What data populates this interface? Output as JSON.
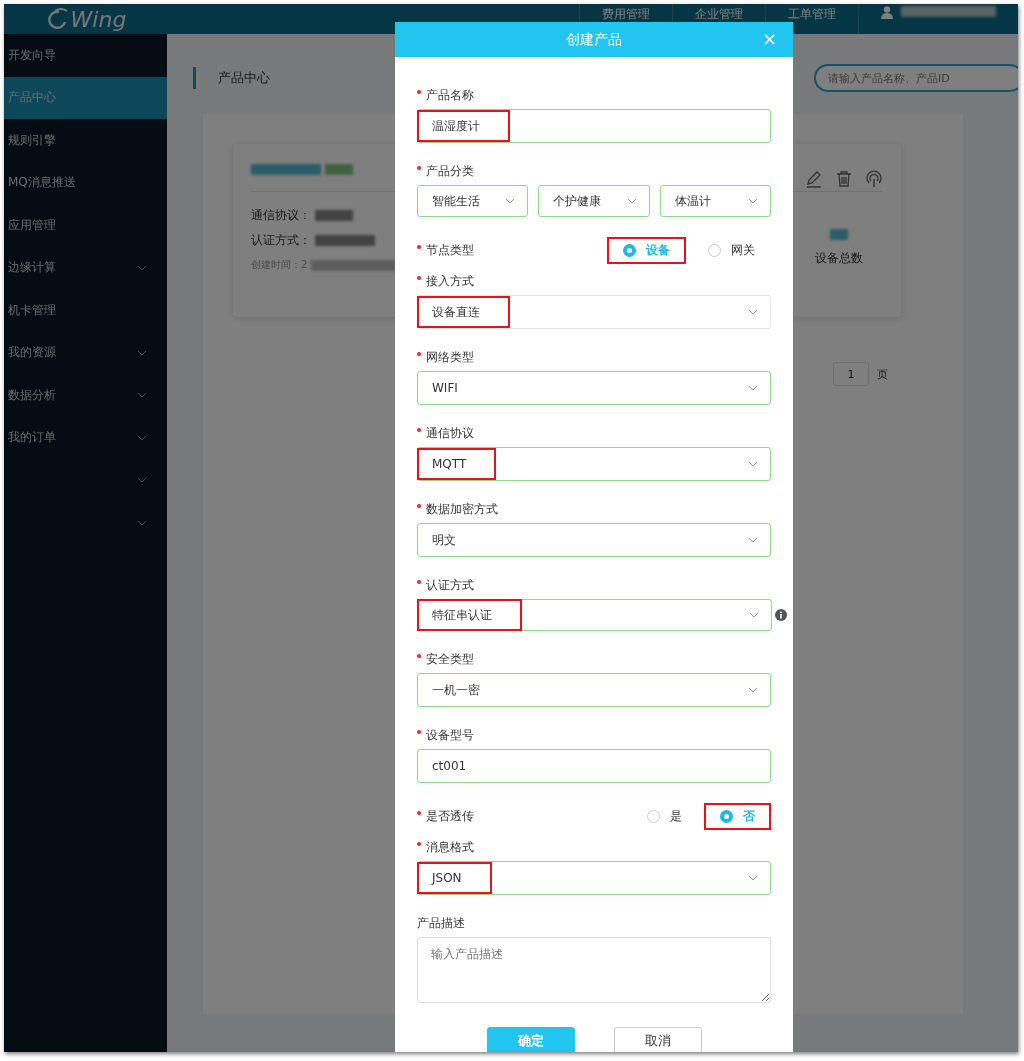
{
  "header": {
    "logo": "Wing",
    "nav": [
      "费用管理",
      "企业管理",
      "工单管理"
    ]
  },
  "sidebar": {
    "items": [
      {
        "label": "开发向导",
        "selected": false,
        "expandable": false
      },
      {
        "label": "产品中心",
        "selected": true,
        "expandable": false
      },
      {
        "label": "规则引擎",
        "selected": false,
        "expandable": false
      },
      {
        "label": "MQ消息推送",
        "selected": false,
        "expandable": false
      },
      {
        "label": "应用管理",
        "selected": false,
        "expandable": false
      },
      {
        "label": "边缘计算",
        "selected": false,
        "expandable": true
      },
      {
        "label": "机卡管理",
        "selected": false,
        "expandable": false
      },
      {
        "label": "我的资源",
        "selected": false,
        "expandable": true
      },
      {
        "label": "数据分析",
        "selected": false,
        "expandable": true
      },
      {
        "label": "我的订单",
        "selected": false,
        "expandable": true
      },
      {
        "selected": false,
        "expandable": true
      },
      {
        "selected": false,
        "expandable": true
      }
    ]
  },
  "main": {
    "title": "产品中心",
    "search": {
      "placeholder": "请输入产品名称、产品ID"
    },
    "card": {
      "rows": [
        "通信协议：",
        "认证方式："
      ],
      "created": "创建时间：2",
      "stat_label": "设备总数"
    },
    "pagination": {
      "page": "1",
      "unit": "页"
    }
  },
  "dialog": {
    "title": "创建产品",
    "close": "×",
    "fields": [
      {
        "kind": "text",
        "label": "产品名称",
        "required": true,
        "value": "温湿度计",
        "highlighted": true,
        "valid": true
      },
      {
        "kind": "cascade",
        "label": "产品分类",
        "required": true,
        "values": [
          "智能生活",
          "个护健康",
          "体温计"
        ],
        "valid": true
      },
      {
        "kind": "radio",
        "label": "节点类型",
        "required": true,
        "options": [
          {
            "label": "设备",
            "selected": true,
            "highlighted": true
          },
          {
            "label": "网关",
            "selected": false,
            "highlighted": false
          }
        ]
      },
      {
        "kind": "select",
        "label": "接入方式",
        "required": true,
        "value": "设备直连",
        "highlighted": true,
        "valid": false
      },
      {
        "kind": "select",
        "label": "网络类型",
        "required": true,
        "value": "WIFI",
        "highlighted": false,
        "valid": true
      },
      {
        "kind": "select",
        "label": "通信协议",
        "required": true,
        "value": "MQTT",
        "highlighted": true,
        "valid": true
      },
      {
        "kind": "select",
        "label": "数据加密方式",
        "required": true,
        "value": "明文",
        "highlighted": false,
        "valid": true
      },
      {
        "kind": "select",
        "label": "认证方式",
        "required": true,
        "value": "特征串认证",
        "highlighted": true,
        "valid": true,
        "info": true
      },
      {
        "kind": "select",
        "label": "安全类型",
        "required": true,
        "value": "一机一密",
        "highlighted": false,
        "valid": true
      },
      {
        "kind": "text",
        "label": "设备型号",
        "required": true,
        "value": "ct001",
        "highlighted": false,
        "valid": true
      },
      {
        "kind": "radio",
        "label": "是否透传",
        "required": true,
        "options": [
          {
            "label": "是",
            "selected": false,
            "highlighted": false
          },
          {
            "label": "否",
            "selected": true,
            "highlighted": true
          }
        ]
      },
      {
        "kind": "select",
        "label": "消息格式",
        "required": true,
        "value": "JSON",
        "highlighted": true,
        "valid": true
      },
      {
        "kind": "textarea",
        "label": "产品描述",
        "required": false,
        "placeholder": "输入产品描述"
      }
    ],
    "buttons": [
      {
        "label": "确定",
        "primary": true
      },
      {
        "label": "取消",
        "primary": false
      }
    ]
  }
}
